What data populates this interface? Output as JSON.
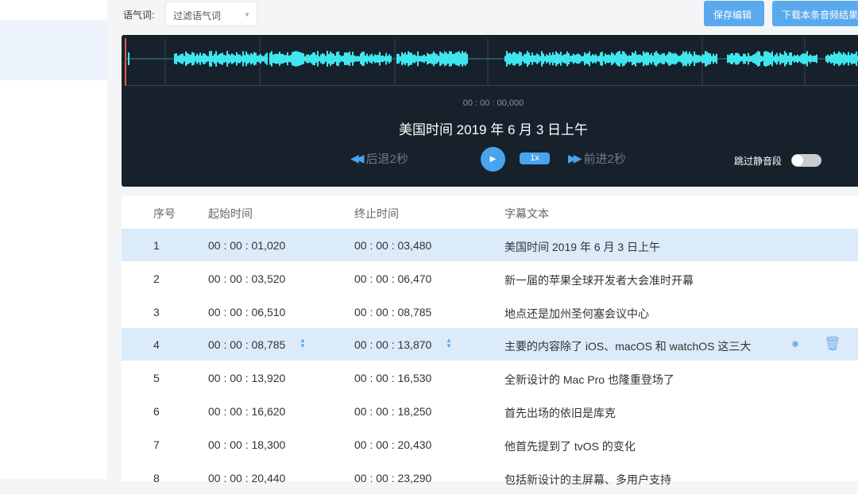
{
  "filter": {
    "label": "语气词:",
    "placeholder": "过滤语气词"
  },
  "toolbar": {
    "save": "保存编辑",
    "download": "下载本条音频结果"
  },
  "player": {
    "time": "00 : 00 : 00,000",
    "caption": "美国时间 2019 年 6 月 3 日上午",
    "back": "后退2秒",
    "forward": "前进2秒",
    "speed": "1x",
    "skip_silence": "跳过静音段",
    "skip_silence_on": false
  },
  "table": {
    "headers": [
      "序号",
      "起始时间",
      "终止时间",
      "字幕文本"
    ],
    "rows": [
      {
        "n": "1",
        "start": "00 : 00 : 01,020",
        "end": "00 : 00 : 03,480",
        "text": "美国时间 2019 年 6 月 3 日上午"
      },
      {
        "n": "2",
        "start": "00 : 00 : 03,520",
        "end": "00 : 00 : 06,470",
        "text": "新一届的苹果全球开发者大会准时开幕"
      },
      {
        "n": "3",
        "start": "00 : 00 : 06,510",
        "end": "00 : 00 : 08,785",
        "text": "地点还是加州圣何塞会议中心"
      },
      {
        "n": "4",
        "start": "00 : 00 : 08,785",
        "end": "00 : 00 : 13,870",
        "text": "主要的内容除了 iOS、macOS 和 watchOS 这三大"
      },
      {
        "n": "5",
        "start": "00 : 00 : 13,920",
        "end": "00 : 00 : 16,530",
        "text": "全新设计的 Mac Pro 也隆重登场了"
      },
      {
        "n": "6",
        "start": "00 : 00 : 16,620",
        "end": "00 : 00 : 18,250",
        "text": "首先出场的依旧是库克"
      },
      {
        "n": "7",
        "start": "00 : 00 : 18,300",
        "end": "00 : 00 : 20,430",
        "text": "他首先提到了 tvOS 的变化"
      },
      {
        "n": "8",
        "start": "00 : 00 : 20,440",
        "end": "00 : 00 : 23,290",
        "text": "包括新设计的主屏幕、多用户支持"
      }
    ]
  }
}
